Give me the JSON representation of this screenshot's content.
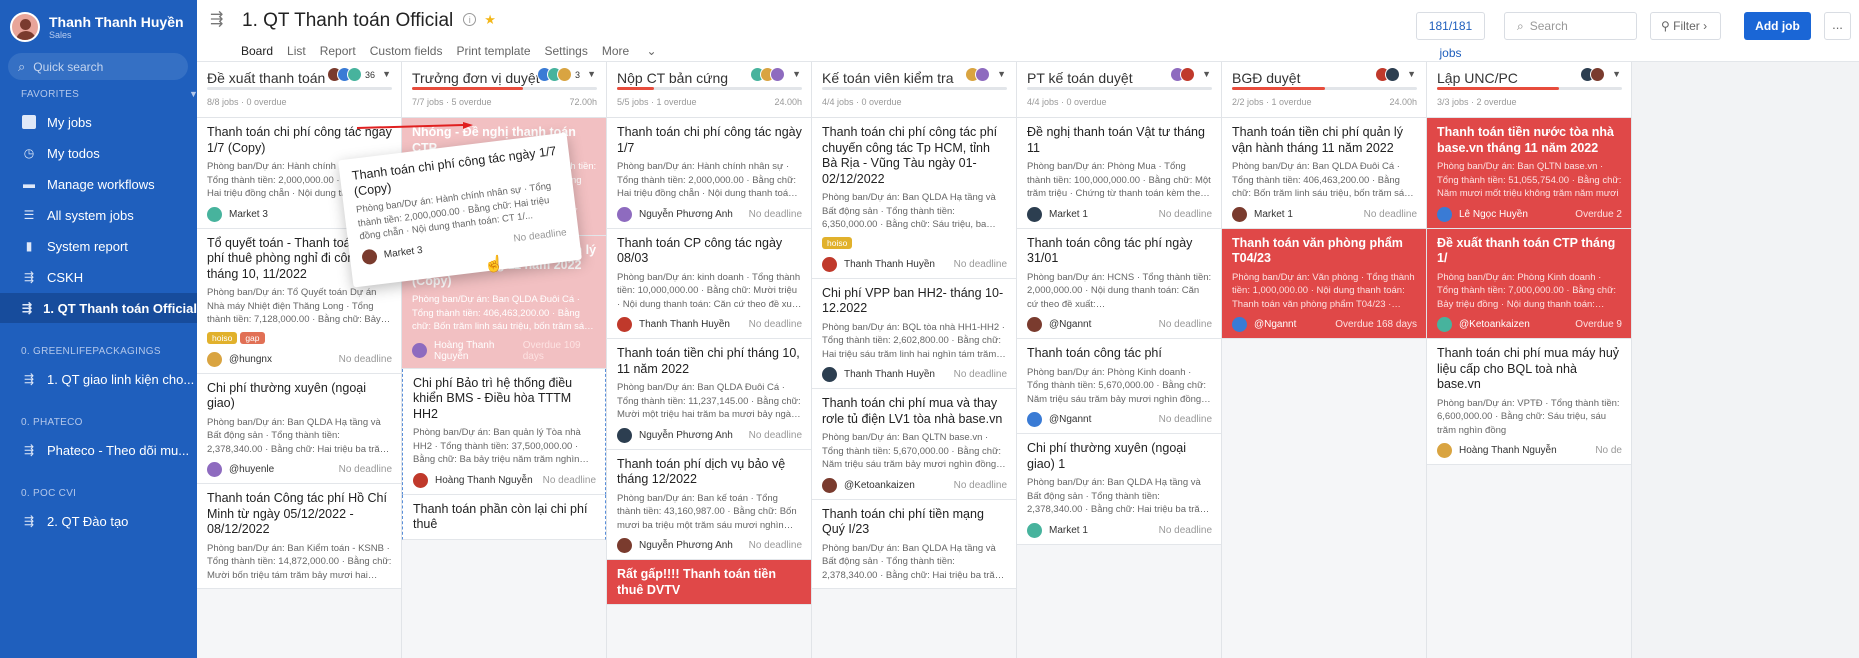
{
  "user": {
    "name": "Thanh Thanh Huyền",
    "role": "Sales"
  },
  "sidebar": {
    "search_placeholder": "Quick search",
    "favorites_title": "FAVORITES",
    "items": [
      {
        "label": "My jobs",
        "icon": "checkbox-icon"
      },
      {
        "label": "My todos",
        "icon": "clock-icon"
      },
      {
        "label": "Manage workflows",
        "icon": "folder-icon"
      },
      {
        "label": "All system jobs",
        "icon": "list-icon"
      },
      {
        "label": "System report",
        "icon": "bar-chart-icon"
      },
      {
        "label": "CSKH",
        "icon": "workflow-icon"
      },
      {
        "label": "1. QT Thanh toán Official",
        "icon": "workflow-icon"
      }
    ],
    "groups": [
      {
        "title": "0. GREENLIFEPACKAGINGS",
        "item": "1. QT giao linh kiện cho..."
      },
      {
        "title": "0. PHATECO",
        "item": "Phateco - Theo dõi mu..."
      },
      {
        "title": "0. POC CVI",
        "item": "2. QT Đào tạo"
      }
    ]
  },
  "header": {
    "title": "1. QT Thanh toán Official",
    "tabs": [
      "Board",
      "List",
      "Report",
      "Custom fields",
      "Print template",
      "Settings",
      "More"
    ],
    "jobs_count": "181/181 jobs",
    "search_placeholder": "Search",
    "filter_label": "Filter",
    "add_label": "Add job",
    "more_label": "..."
  },
  "columns": [
    {
      "name": "Đề xuất thanh toán",
      "stats": "8/8 jobs · 0 overdue",
      "time": "",
      "count": "36",
      "progress": 0,
      "cards": [
        {
          "title": "Thanh toán chi phí công tác ngày 1/7 (Copy)",
          "desc": "Phòng ban/Dự án: Hành chính nhân sự · Tổng thành tiền: 2,000,000.00 · Bằng chữ: Hai triệu đồng chẵn · Nội dung thanh toán",
          "person": "Market 3",
          "deadline": "",
          "style": ""
        },
        {
          "title": "Tổ quyết toán - Thanh toán chi phí thuê phòng nghỉ đi công tác tháng 10, 11/2022",
          "desc": "Phòng ban/Dự án: Tổ Quyết toán Dự án Nhà máy Nhiệt điện Thăng Long · Tổng thành tiền: 7,128,000.00 · Bằng chữ: Bảy triệu một...",
          "person": "@hungnx",
          "deadline": "No deadline",
          "tags": [
            "hoiso",
            "gap"
          ],
          "style": ""
        },
        {
          "title": "Chi phí thường xuyên (ngoại giao)",
          "desc": "Phòng ban/Dự án: Ban QLDA Hạ tầng và Bất động sản · Tổng thành tiền: 2,378,340.00 · Bằng chữ: Hai triệu ba trăm bảy mươi tám...",
          "person": "@huyenle",
          "deadline": "No deadline",
          "style": ""
        },
        {
          "title": "Thanh toán Công tác phí Hồ Chí Minh từ ngày 05/12/2022 - 08/12/2022",
          "desc": "Phòng ban/Dự án: Ban Kiểm toán - KSNB · Tổng thành tiền: 14,872,000.00 · Bằng chữ: Mười bốn triệu tám trăm bảy mươi hai nghìn...",
          "person": "",
          "deadline": "",
          "style": ""
        }
      ]
    },
    {
      "name": "Trưởng đơn vị duyệt",
      "stats": "7/7 jobs · 5 overdue",
      "time": "72.00h",
      "count": "3",
      "progress": 0.6,
      "cards": [
        {
          "title": "Nhóng - Đề nghị thanh toán CTP",
          "desc": "Phòng ban/Dự án: HCNS · Tổng thành tiền: 2,000,000.00 · Bằng chữ: Hai triệu đồng chẵn",
          "person": "Hoàng Thanh Nguyễn",
          "deadline": "Overdue 47 days",
          "style": "pink"
        },
        {
          "title": "Thanh toán tiền chi phí quản lý vận hành tháng 11 năm 2022 (Copy)",
          "desc": "Phòng ban/Dự án: Ban QLDA Đuôi Cá · Tổng thành tiền: 406,463,200.00 · Bằng chữ: Bốn trăm linh sáu triệu, bốn trăm sáu mươi...",
          "person": "Hoàng Thanh Nguyễn",
          "deadline": "Overdue 109 days",
          "style": "pink"
        },
        {
          "title": "Chi phí Bảo trì hệ thống điều khiển BMS - Điều hòa TTTM HH2",
          "desc": "Phòng ban/Dự án: Ban quản lý Tòa nhà HH2 · Tổng thành tiền: 37,500,000.00 · Bằng chữ: Ba bảy triệu năm trăm nghìn đồng chẵn...",
          "person": "Hoàng Thanh Nguyễn",
          "deadline": "No deadline",
          "style": "dash"
        },
        {
          "title": "Thanh toán phần còn lại chi phí thuê",
          "desc": "",
          "person": "",
          "deadline": "",
          "style": "dash"
        }
      ]
    },
    {
      "name": "Nộp CT bản cứng",
      "stats": "5/5 jobs · 1 overdue",
      "time": "24.00h",
      "count": "",
      "progress": 0.2,
      "cards": [
        {
          "title": "Thanh toán chi phí công tác ngày 1/7",
          "desc": "Phòng ban/Dự án: Hành chính nhân sự · Tổng thành tiền: 2,000,000.00 · Bằng chữ: Hai triệu đồng chẵn · Nội dung thanh toán: CT...",
          "person": "Nguyễn Phương Anh",
          "deadline": "No deadline",
          "style": ""
        },
        {
          "title": "Thanh toán CP công tác ngày 08/03",
          "desc": "Phòng ban/Dự án: kinh doanh · Tổng thành tiền: 10,000,000.00 · Bằng chữ: Mười triệu · Nội dung thanh toán: Căn cứ theo đề xuất đã dc duy...",
          "person": "Thanh Thanh Huyền",
          "deadline": "No deadline",
          "style": ""
        },
        {
          "title": "Thanh toán tiền chi phí tháng 10, 11 năm 2022",
          "desc": "Phòng ban/Dự án: Ban QLDA Đuôi Cá · Tổng thành tiền: 11,237,145.00 · Bằng chữ: Mười một triệu hai trăm ba mươi bảy ngàn một...",
          "person": "Nguyễn Phương Anh",
          "deadline": "No deadline",
          "style": ""
        },
        {
          "title": "Thanh toán phí dịch vụ bảo vệ tháng 12/2022",
          "desc": "Phòng ban/Dự án: Ban kế toán · Tổng thành tiền: 43,160,987.00 · Bằng chữ: Bốn mươi ba triệu một trăm sáu mươi nghìn chín trăm...",
          "person": "Nguyễn Phương Anh",
          "deadline": "No deadline",
          "style": ""
        },
        {
          "title": "Rất gấp!!!! Thanh toán tiền thuê DVTV",
          "desc": "",
          "person": "",
          "deadline": "",
          "style": "red"
        }
      ]
    },
    {
      "name": "Kế toán viên kiểm tra",
      "stats": "4/4 jobs · 0 overdue",
      "time": "",
      "count": "",
      "progress": 0,
      "cards": [
        {
          "title": "Thanh toán chi phí công tác phí chuyến công tác Tp HCM, tỉnh Bà Rịa - Vũng Tàu ngày 01-02/12/2022",
          "desc": "Phòng ban/Dự án: Ban QLDA Hạ tầng và Bất động sản · Tổng thành tiền: 6,350,000.00 · Bằng chữ: Sáu triệu, ba trăm năm mươi...",
          "person": "Thanh Thanh Huyền",
          "deadline": "No deadline",
          "tags": [
            "hoiso"
          ],
          "style": ""
        },
        {
          "title": "Chi phí VPP ban HH2- tháng 10-12.2022",
          "desc": "Phòng ban/Dự án: BQL tòa nhà HH1-HH2 · Tổng thành tiền: 2,602,800.00 · Bằng chữ: Hai triệu sáu trăm linh hai nghìn tám trăm đồn...",
          "person": "Thanh Thanh Huyền",
          "deadline": "No deadline",
          "style": ""
        },
        {
          "title": "Thanh toán chi phí mua và thay rơle tủ điện LV1 tòa nhà base.vn",
          "desc": "Phòng ban/Dự án: Ban QLTN base.vn · Tổng thành tiền: 5,670,000.00 · Bằng chữ: Năm triệu sáu trăm bảy mươi nghìn đồng · Nội...",
          "person": "@Ketoankaizen",
          "deadline": "No deadline",
          "style": ""
        },
        {
          "title": "Thanh toán chi phí tiền mạng Quý I/23",
          "desc": "Phòng ban/Dự án: Ban QLDA Hạ tầng và Bất động sản · Tổng thành tiền: 2,378,340.00 · Bằng chữ: Hai triệu ba trăm bảy mươi tám...",
          "person": "",
          "deadline": "",
          "style": ""
        }
      ]
    },
    {
      "name": "PT kế toán duyệt",
      "stats": "4/4 jobs · 0 overdue",
      "time": "",
      "count": "",
      "progress": 0,
      "cards": [
        {
          "title": "Đề nghị thanh toán Vật tư tháng 11",
          "desc": "Phòng ban/Dự án: Phòng Mua · Tổng thành tiền: 100,000,000.00 · Bằng chữ: Một trăm triệu · Chứng từ thanh toán kèm theo gồm:...",
          "person": "Market 1",
          "deadline": "No deadline",
          "style": ""
        },
        {
          "title": "Thanh toán công tác phí ngày 31/01",
          "desc": "Phòng ban/Dự án: HCNS · Tổng thành tiền: 2,000,000.00 · Nội dung thanh toán: Căn cứ theo đề xuất: https://request.base.vn/home...",
          "person": "@Ngannt",
          "deadline": "No deadline",
          "style": ""
        },
        {
          "title": "Thanh toán công tác phí",
          "desc": "Phòng ban/Dự án: Phòng Kinh doanh · Tổng thành tiền: 5,670,000.00 · Bằng chữ: Năm triệu sáu trăm bảy mươi nghìn đồng · Nội...",
          "person": "@Ngannt",
          "deadline": "No deadline",
          "style": ""
        },
        {
          "title": "Chi phí thường xuyên (ngoại giao) 1",
          "desc": "Phòng ban/Dự án: Ban QLDA Hạ tầng và Bất động sản · Tổng thành tiền: 2,378,340.00 · Bằng chữ: Hai triệu ba trăm bảy mươi tám...",
          "person": "Market 1",
          "deadline": "No deadline",
          "style": ""
        }
      ]
    },
    {
      "name": "BGĐ duyệt",
      "stats": "2/2 jobs · 1 overdue",
      "time": "24.00h",
      "count": "",
      "progress": 0.5,
      "cards": [
        {
          "title": "Thanh toán tiền chi phí quản lý vận hành tháng 11 năm 2022",
          "desc": "Phòng ban/Dự án: Ban QLDA Đuôi Cá · Tổng thành tiền: 406,463,200.00 · Bằng chữ: Bốn trăm linh sáu triệu, bốn trăm sáu mươi...",
          "person": "Market 1",
          "deadline": "No deadline",
          "style": ""
        },
        {
          "title": "Thanh toán văn phòng phẩm T04/23",
          "desc": "Phòng ban/Dự án: Văn phòng · Tổng thành tiền: 1,000,000.00 · Nội dung thanh toán: Thanh toán văn phòng phẩm T04/23 · Chứ...",
          "person": "@Ngannt",
          "deadline": "Overdue 168 days",
          "style": "red"
        }
      ]
    },
    {
      "name": "Lập UNC/PC",
      "stats": "3/3 jobs · 2 overdue",
      "time": "",
      "count": "",
      "progress": 0.66,
      "cards": [
        {
          "title": "Thanh toán tiền nước tòa nhà base.vn tháng 11 năm 2022",
          "desc": "Phòng ban/Dự án: Ban QLTN base.vn · Tổng thành tiền: 51,055,754.00 · Bằng chữ: Năm mươi mốt triệu không trăm năm mươi",
          "person": "Lê Ngọc Huyền",
          "deadline": "Overdue 2",
          "style": "red"
        },
        {
          "title": "Đề xuất thanh toán CTP tháng 1/",
          "desc": "Phòng ban/Dự án: Phòng Kinh doanh · Tổng thành tiền: 7,000,000.00 · Bằng chữ: Bảy triệu đồng · Nội dung thanh toán: Thanh",
          "person": "@Ketoankaizen",
          "deadline": "Overdue 9",
          "style": "red"
        },
        {
          "title": "Thanh toán chi phí mua máy huỷ liệu cấp cho BQL toà nhà base.vn",
          "desc": "Phòng ban/Dự án: VPTĐ · Tổng thành tiền: 6,600,000.00 · Bằng chữ: Sáu triệu, sáu trăm nghìn đồng",
          "person": "Hoàng Thanh Nguyễn",
          "deadline": "No de",
          "style": ""
        }
      ]
    }
  ],
  "drag_card": {
    "title": "Thanh toán chi phí công tác ngày 1/7 (Copy)",
    "desc": "Phòng ban/Dự án: Hành chính nhân sự · Tổng thành tiền: 2,000,000.00 · Bằng chữ: Hai triệu đồng chẵn · Nội dung thanh toán: CT 1/...",
    "person": "Market 3",
    "deadline": "No deadline"
  },
  "colors": {
    "sidebar": "#1f5fbd",
    "accent": "#1a66d6",
    "overdue": "#e04848"
  }
}
